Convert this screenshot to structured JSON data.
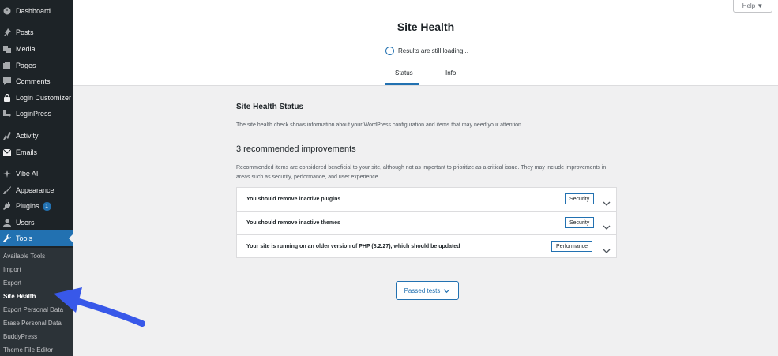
{
  "sidebar": {
    "items": [
      {
        "label": "Dashboard",
        "icon": "dashboard-icon"
      },
      {
        "label": "Posts",
        "icon": "pin-icon"
      },
      {
        "label": "Media",
        "icon": "media-icon"
      },
      {
        "label": "Pages",
        "icon": "pages-icon"
      },
      {
        "label": "Comments",
        "icon": "comment-icon"
      },
      {
        "label": "Login Customizer",
        "icon": "lock-icon"
      },
      {
        "label": "LoginPress",
        "icon": "arrow-icon"
      },
      {
        "label": "Activity",
        "icon": "activity-icon"
      },
      {
        "label": "Emails",
        "icon": "email-icon"
      },
      {
        "label": "Vibe AI",
        "icon": "sparkle-icon"
      },
      {
        "label": "Appearance",
        "icon": "brush-icon"
      },
      {
        "label": "Plugins",
        "icon": "plug-icon",
        "badge": "1"
      },
      {
        "label": "Users",
        "icon": "user-icon"
      },
      {
        "label": "Tools",
        "icon": "wrench-icon",
        "active": true
      }
    ],
    "submenu": [
      "Available Tools",
      "Import",
      "Export",
      "Site Health",
      "Export Personal Data",
      "Erase Personal Data",
      "BuddyPress",
      "Theme File Editor"
    ],
    "current_submenu": "Site Health"
  },
  "header": {
    "help_label": "Help ▼",
    "title": "Site Health",
    "loading_text": "Results are still loading...",
    "tabs": [
      {
        "label": "Status",
        "active": true
      },
      {
        "label": "Info",
        "active": false
      }
    ]
  },
  "main": {
    "section_title": "Site Health Status",
    "description": "The site health check shows information about your WordPress configuration and items that may need your attention.",
    "recommended_title": "3 recommended improvements",
    "recommended_desc": "Recommended items are considered beneficial to your site, although not as important to prioritize as a critical issue. They may include improvements in areas such as security, performance, and user experience.",
    "issues": [
      {
        "text": "You should remove inactive plugins",
        "tag": "Security"
      },
      {
        "text": "You should remove inactive themes",
        "tag": "Security"
      },
      {
        "text": "Your site is running on an older version of PHP (8.2.27), which should be updated",
        "tag": "Performance"
      }
    ],
    "passed_tests_label": "Passed tests"
  },
  "colors": {
    "accent": "#2271b1",
    "sidebar_bg": "#1d2327",
    "annotation_arrow": "#3858e9"
  }
}
